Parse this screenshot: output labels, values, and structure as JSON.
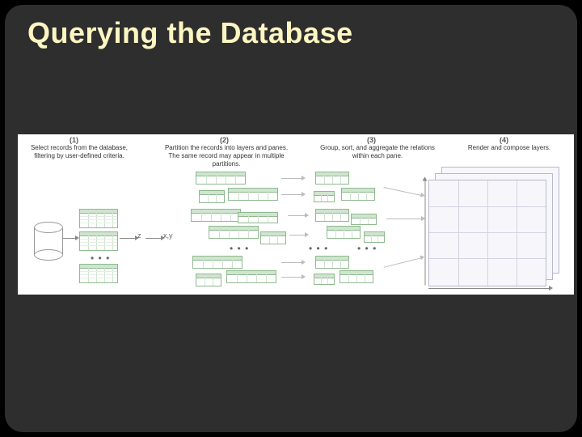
{
  "title": "Querying the Database",
  "steps": {
    "s1": {
      "num": "(1)",
      "caption": "Select records from the database, filtering by user-defined criteria."
    },
    "s2": {
      "num": "(2)",
      "caption": "Partition the records into layers and panes. The same record may appear in multiple partitions."
    },
    "s3": {
      "num": "(3)",
      "caption": "Group, sort, and aggregate the relations within each pane."
    },
    "s4": {
      "num": "(4)",
      "caption": "Render and compose layers."
    }
  },
  "labels": {
    "z": "z",
    "xy": "x,y"
  },
  "ellipsis": "• • •"
}
